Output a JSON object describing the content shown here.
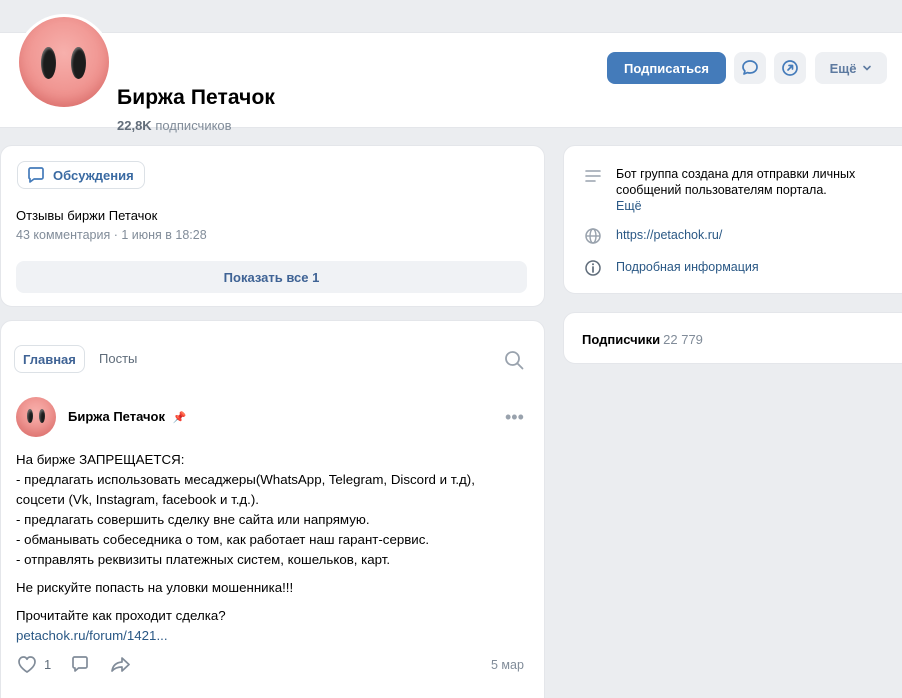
{
  "colors": {
    "accent": "#447bba",
    "link": "#2a5885",
    "muted": "#818c99",
    "background": "#ebedf0"
  },
  "group": {
    "name": "Биржа Петачок",
    "subscribers_count": "22,8K",
    "subscribers_label": "подписчиков",
    "subscribe_label": "Подписаться",
    "more_label": "Ещё"
  },
  "discussions": {
    "button_label": "Обсуждения",
    "topic_title": "Отзывы биржи Петачок",
    "topic_meta": "43 комментария · 1 июня в 18:28",
    "show_all_label": "Показать все 1"
  },
  "info": {
    "description": "Бот группа создана для отправки личных сообщений пользователям портала.",
    "more_label": "Ещё",
    "website": "https://petachok.ru/",
    "details_label": "Подробная информация"
  },
  "subscribers_block": {
    "label": "Подписчики",
    "count": "22 779"
  },
  "wall": {
    "tab_main": "Главная",
    "tab_posts": "Посты",
    "post": {
      "author": "Биржа Петачок",
      "pin_icon": "pin-icon",
      "lines": [
        "На бирже ЗАПРЕЩАЕТСЯ:",
        "- предлагать использовать месаджеры(WhatsApp, Telegram, Discord и т.д),",
        "соцсети (Vk, Instagram, facebook и т.д.).",
        "- предлагать совершить сделку вне сайта или напрямую.",
        "- обманывать собеседника о том, как работает наш гарант-сервис.",
        "- отправлять реквизиты платежных систем, кошельков, карт."
      ],
      "warning": "Не рискуйте попасть на уловки мошенника!!!",
      "question": "Прочитайте как проходит сделка?",
      "link": "petachok.ru/forum/1421...",
      "likes": "1",
      "date": "5 мар"
    }
  }
}
